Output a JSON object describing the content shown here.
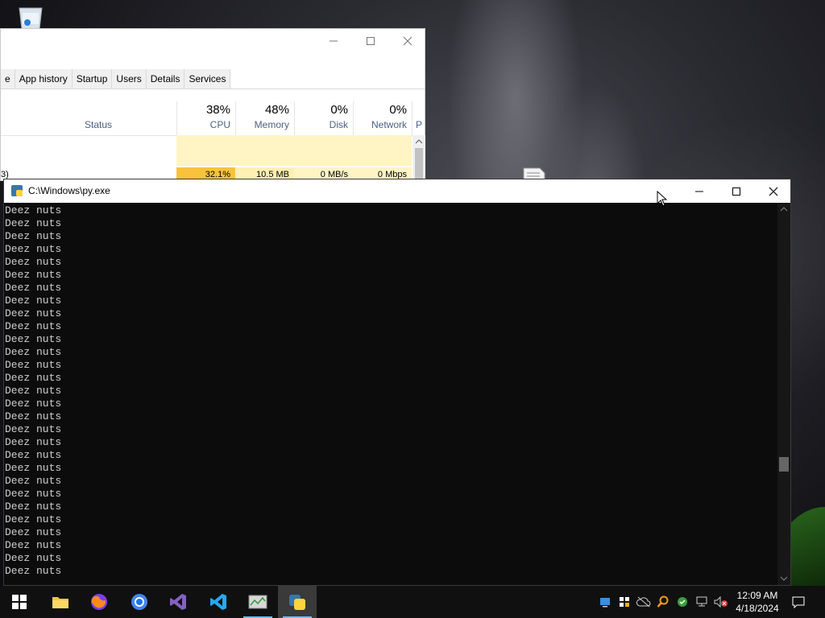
{
  "taskmgr": {
    "tabs": [
      "e",
      "App history",
      "Startup",
      "Users",
      "Details",
      "Services"
    ],
    "status_label": "Status",
    "columns": [
      {
        "pct": "38%",
        "label": "CPU"
      },
      {
        "pct": "48%",
        "label": "Memory"
      },
      {
        "pct": "0%",
        "label": "Disk"
      },
      {
        "pct": "0%",
        "label": "Network"
      }
    ],
    "extra_column_letter": "P",
    "process_row": {
      "name_fragment": "3)",
      "cpu": "32.1%",
      "memory": "10.5 MB",
      "disk": "0 MB/s",
      "network": "0 Mbps"
    }
  },
  "console": {
    "title": "C:\\Windows\\py.exe",
    "line_text": "Deez nuts",
    "line_count": 29
  },
  "clock": {
    "time": "12:09 AM",
    "date": "4/18/2024"
  },
  "colors": {
    "cpu_highlight": "#f9c23c",
    "empty_highlight": "#fff4c4",
    "console_bg": "#0c0c0c",
    "accent": "#76b9ed"
  }
}
